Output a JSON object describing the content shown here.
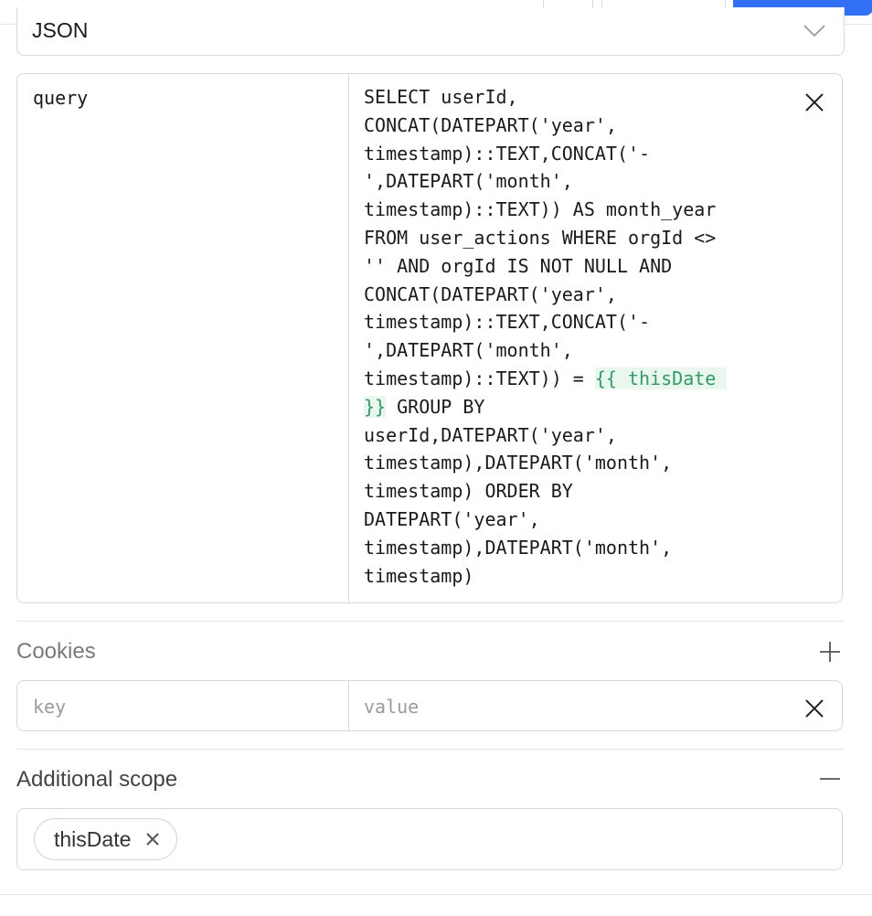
{
  "format_select": {
    "value": "JSON"
  },
  "params": [
    {
      "key": "query",
      "value_before": "SELECT userId,\nCONCAT(DATEPART('year',\ntimestamp)::TEXT,CONCAT('-\n',DATEPART('month',\ntimestamp)::TEXT)) AS month_year\nFROM user_actions WHERE orgId <>\n'' AND orgId IS NOT NULL AND\nCONCAT(DATEPART('year',\ntimestamp)::TEXT,CONCAT('-\n',DATEPART('month',\ntimestamp)::TEXT)) = ",
      "template_part1": "{{ thisDate ",
      "template_part2": "}}",
      "value_after": " GROUP BY\nuserId,DATEPART('year',\ntimestamp),DATEPART('month',\ntimestamp) ORDER BY\nDATEPART('year',\ntimestamp),DATEPART('month',\ntimestamp)"
    }
  ],
  "cookies": {
    "title": "Cookies",
    "key_placeholder": "key",
    "value_placeholder": "value"
  },
  "additional_scope": {
    "title": "Additional scope",
    "chips": [
      "thisDate"
    ]
  },
  "icons": {
    "chevron": "chevron-down-icon",
    "remove": "close-icon",
    "add": "plus-icon",
    "collapse": "minus-icon"
  },
  "colors": {
    "primary": "#3170f5",
    "template_text": "#2f9d63",
    "template_bg": "#e9f7ef"
  }
}
